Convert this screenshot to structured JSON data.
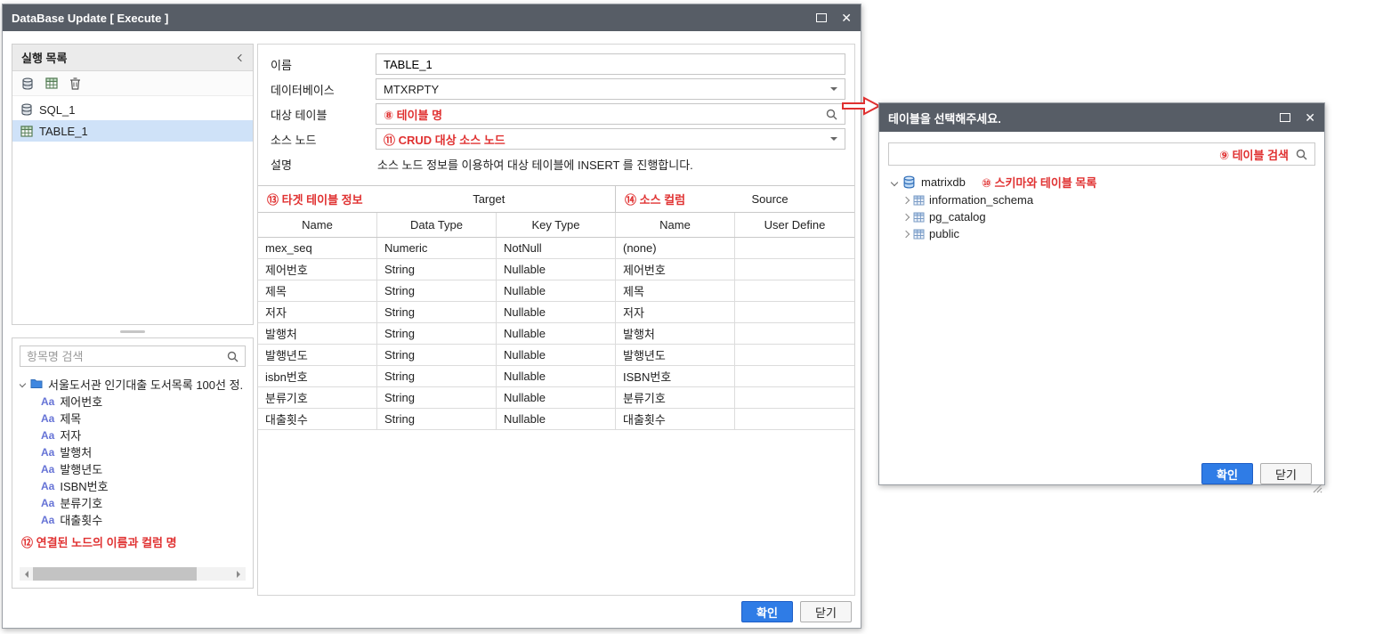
{
  "colors": {
    "accent_red": "#e03232",
    "primary_blue": "#2f7ce6",
    "titlebar": "#575d66"
  },
  "left_window": {
    "title": "DataBase Update [ Execute ]",
    "sidebar": {
      "header": "실행 목록",
      "items": [
        {
          "label": "SQL_1"
        },
        {
          "label": "TABLE_1"
        }
      ],
      "search_placeholder": "항목명 검색",
      "tree": {
        "root_label": "서울도서관 인기대출 도서목록 100선 정.",
        "item_icon": "Aa",
        "children": [
          "제어번호",
          "제목",
          "저자",
          "발행처",
          "발행년도",
          "ISBN번호",
          "분류기호",
          "대출횟수"
        ],
        "annotation": "⑫ 연결된 노드의 이름과 컬럼 명"
      }
    },
    "form": {
      "name_label": "이름",
      "name_value": "TABLE_1",
      "database_label": "데이터베이스",
      "database_value": "MTXRPTY",
      "target_table_label": "대상 테이블",
      "target_table_value": "⑧ 테이블 명",
      "source_node_label": "소스 노드",
      "source_node_value": "⑪ CRUD 대상 소스 노드",
      "description_label": "설명",
      "description_value": "소스 노드 정보를 이용하여 대상 테이블에 INSERT 를 진행합니다."
    },
    "mapping_table": {
      "groups": [
        {
          "annotation": "⑬ 타겟 테이블 정보",
          "label": "Target"
        },
        {
          "annotation": "⑭ 소스 컬럼",
          "label": "Source"
        }
      ],
      "columns": [
        "Name",
        "Data Type",
        "Key Type",
        "Name",
        "User Define"
      ],
      "rows": [
        [
          "mex_seq",
          "Numeric",
          "NotNull",
          "(none)",
          ""
        ],
        [
          "제어번호",
          "String",
          "Nullable",
          "제어번호",
          ""
        ],
        [
          "제목",
          "String",
          "Nullable",
          "제목",
          ""
        ],
        [
          "저자",
          "String",
          "Nullable",
          "저자",
          ""
        ],
        [
          "발행처",
          "String",
          "Nullable",
          "발행처",
          ""
        ],
        [
          "발행년도",
          "String",
          "Nullable",
          "발행년도",
          ""
        ],
        [
          "isbn번호",
          "String",
          "Nullable",
          "ISBN번호",
          ""
        ],
        [
          "분류기호",
          "String",
          "Nullable",
          "분류기호",
          ""
        ],
        [
          "대출횟수",
          "String",
          "Nullable",
          "대출횟수",
          ""
        ]
      ]
    },
    "footer": {
      "ok_label": "확인",
      "close_label": "닫기"
    }
  },
  "right_window": {
    "title": "테이블을 선택해주세요.",
    "search_value": "⑨ 테이블 검색",
    "tree": {
      "root_label": "matrixdb",
      "annotation": "⑩ 스키마와 테이블 목록",
      "children": [
        "information_schema",
        "pg_catalog",
        "public"
      ]
    },
    "footer": {
      "ok_label": "확인",
      "close_label": "닫기"
    }
  }
}
